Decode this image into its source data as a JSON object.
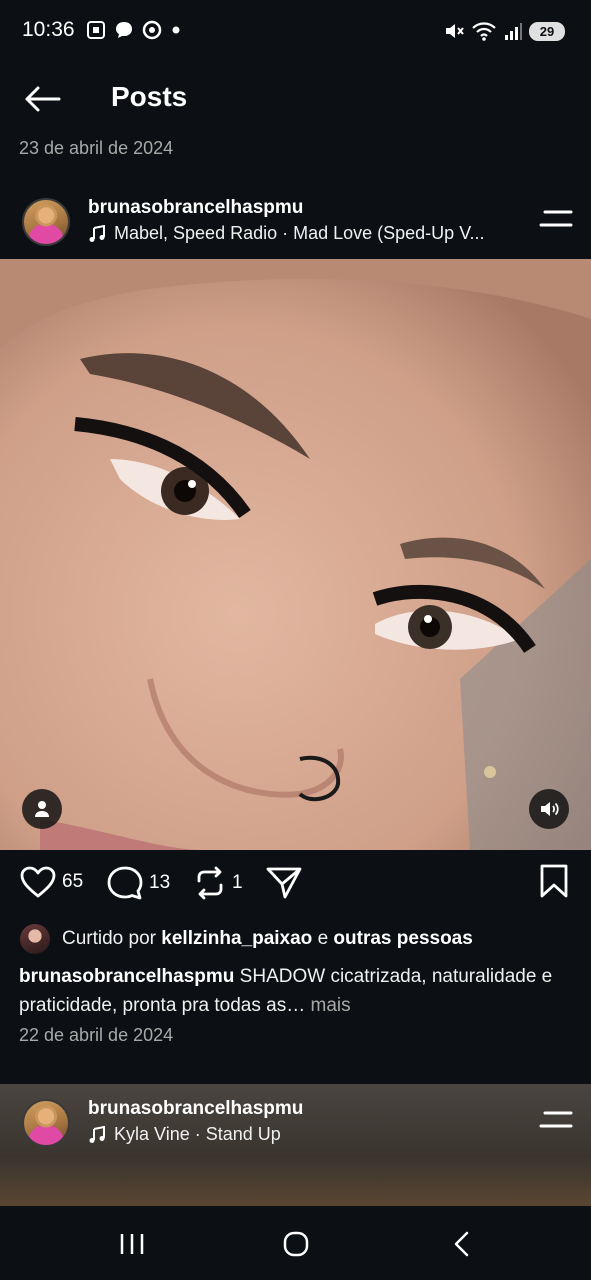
{
  "status_bar": {
    "time": "10:36",
    "battery": "29",
    "left_icons": [
      "screenshot-icon",
      "chat-icon",
      "chrome-icon",
      "dot-icon"
    ],
    "right_icons": [
      "mute-icon",
      "wifi-icon",
      "signal-icon"
    ]
  },
  "header": {
    "title": "Posts"
  },
  "top_date": "23 de abril de 2024",
  "post": {
    "username": "brunasobrancelhaspmu",
    "music": "Mabel, Speed Radio · Mad Love (Sped-Up V...",
    "likes": "65",
    "comments": "13",
    "reposts": "1",
    "liked_by_prefix": "Curtido por ",
    "liked_by_user": "kellzinha_paixao",
    "liked_by_and": " e ",
    "liked_by_others": "outras pessoas",
    "caption_user": "brunasobrancelhaspmu",
    "caption_text": " SHADOW cicatrizada, naturalidade e praticidade, pronta pra todas as…",
    "more": " mais",
    "date": "22 de abril de 2024"
  },
  "second_post": {
    "username": "brunasobrancelhaspmu",
    "music": "Kyla Vine · Stand Up"
  },
  "colors": {
    "background": "#0c1014",
    "text": "#f5f5f5",
    "muted": "#a8a8a8"
  }
}
